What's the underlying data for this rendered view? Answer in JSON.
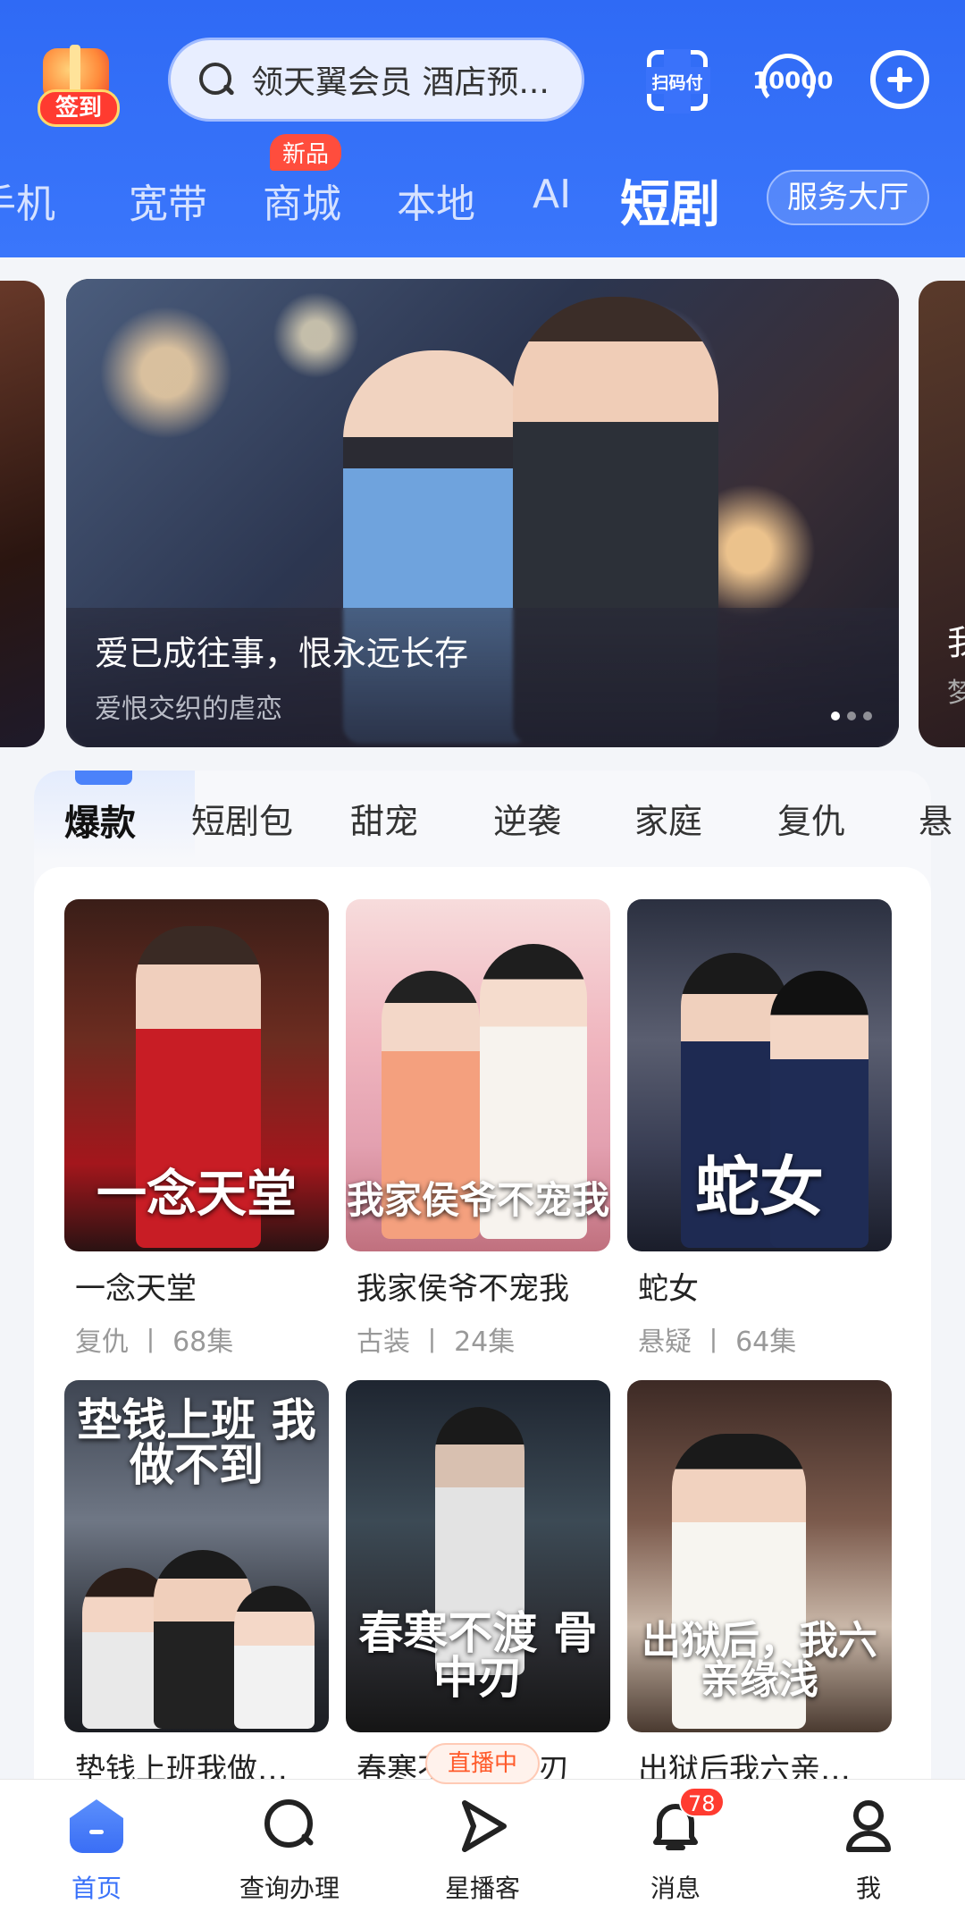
{
  "header": {
    "signin_label": "签到",
    "search_placeholder": "领天翼会员 酒店预...",
    "scan_label": "扫码付",
    "service_label": "10000",
    "nav_tabs": [
      "手机",
      "宽带",
      "商城",
      "本地",
      "AI",
      "短剧"
    ],
    "active_tab": "短剧",
    "new_badge": "新品",
    "hall_button": "服务大厅"
  },
  "banner": {
    "title": "爱已成往事，恨永远长存",
    "subtitle": "爱恨交织的虐恋",
    "art_title": "爱已成往事 恨永远长存",
    "right_peek_title": "我",
    "right_peek_sub": "梦",
    "dots": 3,
    "active_dot": 0
  },
  "categories": [
    "爆款",
    "短剧包",
    "甜宠",
    "逆袭",
    "家庭",
    "复仇",
    "悬"
  ],
  "active_category": "爆款",
  "dramas": [
    {
      "title": "一念天堂",
      "genre": "复仇",
      "episodes": "68集",
      "poster_text": "一念天堂"
    },
    {
      "title": "我家侯爷不宠我",
      "genre": "古装",
      "episodes": "24集",
      "poster_text": "我家侯爷不宠我"
    },
    {
      "title": "蛇女",
      "genre": "悬疑",
      "episodes": "64集",
      "poster_text": "蛇女"
    },
    {
      "title": "垫钱上班我做…",
      "genre": "",
      "episodes": "",
      "poster_text": "垫钱上班 我做不到"
    },
    {
      "title": "春寒不渡骨中刃",
      "genre": "",
      "episodes": "",
      "poster_text": "春寒不渡 骨中刃"
    },
    {
      "title": "出狱后我六亲…",
      "genre": "",
      "episodes": "",
      "poster_text": "出狱后，我六亲缘浅"
    }
  ],
  "meta_separator": "丨",
  "live_badge": "直播中",
  "bottom_nav": [
    {
      "label": "首页",
      "icon": "home-icon",
      "active": true
    },
    {
      "label": "查询办理",
      "icon": "query-icon",
      "active": false
    },
    {
      "label": "星播客",
      "icon": "play-icon",
      "active": false
    },
    {
      "label": "消息",
      "icon": "bell-icon",
      "active": false,
      "badge": "78"
    },
    {
      "label": "我",
      "icon": "user-icon",
      "active": false
    }
  ],
  "colors": {
    "primary": "#3a72fa",
    "badge_red": "#ff3b30"
  }
}
